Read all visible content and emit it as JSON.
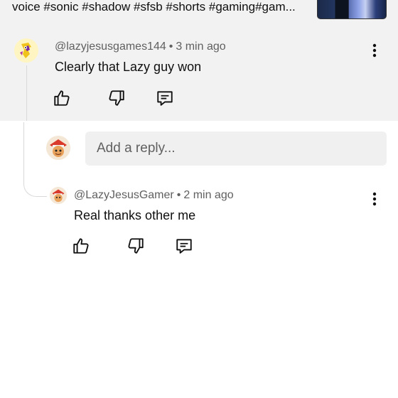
{
  "video": {
    "title_fragment": "voice #sonic #shadow #sfsb #shorts #gaming#gam..."
  },
  "comment": {
    "author": "@lazyjesusgames144",
    "separator": "•",
    "time": "3 min ago",
    "text": "Clearly that Lazy guy won"
  },
  "reply_box": {
    "placeholder": "Add a reply..."
  },
  "reply": {
    "author": "@LazyJesusGamer",
    "separator": "•",
    "time": "2 min ago",
    "text": "Real thanks other me"
  },
  "icons": {
    "like": "thumbs-up-icon",
    "dislike": "thumbs-down-icon",
    "reply": "comment-reply-icon",
    "menu": "more-vertical-icon"
  },
  "colors": {
    "highlight_bg": "#f2f2f2",
    "meta_text": "#606060",
    "text": "#0f0f0f"
  }
}
